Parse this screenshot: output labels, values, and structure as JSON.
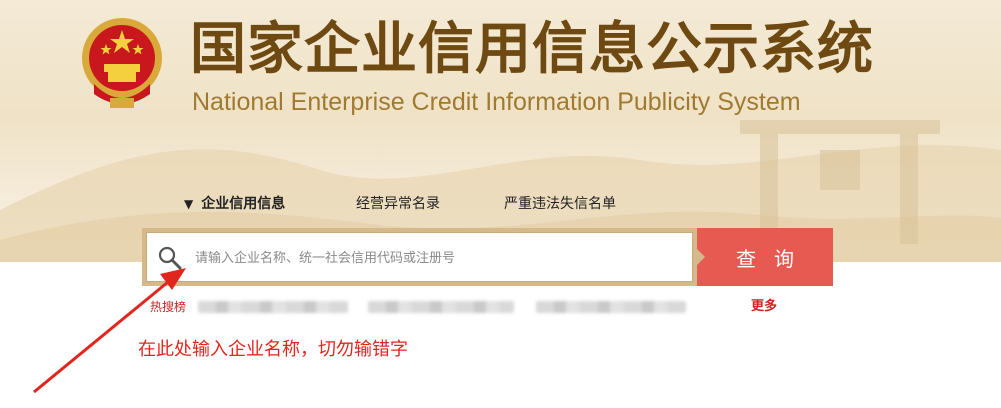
{
  "header": {
    "title_cn": "国家企业信用信息公示系统",
    "title_en": "National Enterprise Credit Information Publicity System",
    "emblem_icon": "national-emblem-icon"
  },
  "tabs": [
    {
      "label": "企业信用信息",
      "active": true
    },
    {
      "label": "经营异常名录",
      "active": false
    },
    {
      "label": "严重违法失信名单",
      "active": false
    }
  ],
  "search": {
    "placeholder": "请输入企业名称、统一社会信用代码或注册号",
    "value": "",
    "button_label": "查询",
    "icon": "search-icon"
  },
  "hot": {
    "label": "热搜榜",
    "more_label": "更多"
  },
  "annotation": {
    "text": "在此处输入企业名称，切勿输错字",
    "color": "#e0261d"
  },
  "colors": {
    "brand_brown": "#6e4a12",
    "button_red": "#e65a52",
    "frame_gold": "#d6b98a"
  }
}
